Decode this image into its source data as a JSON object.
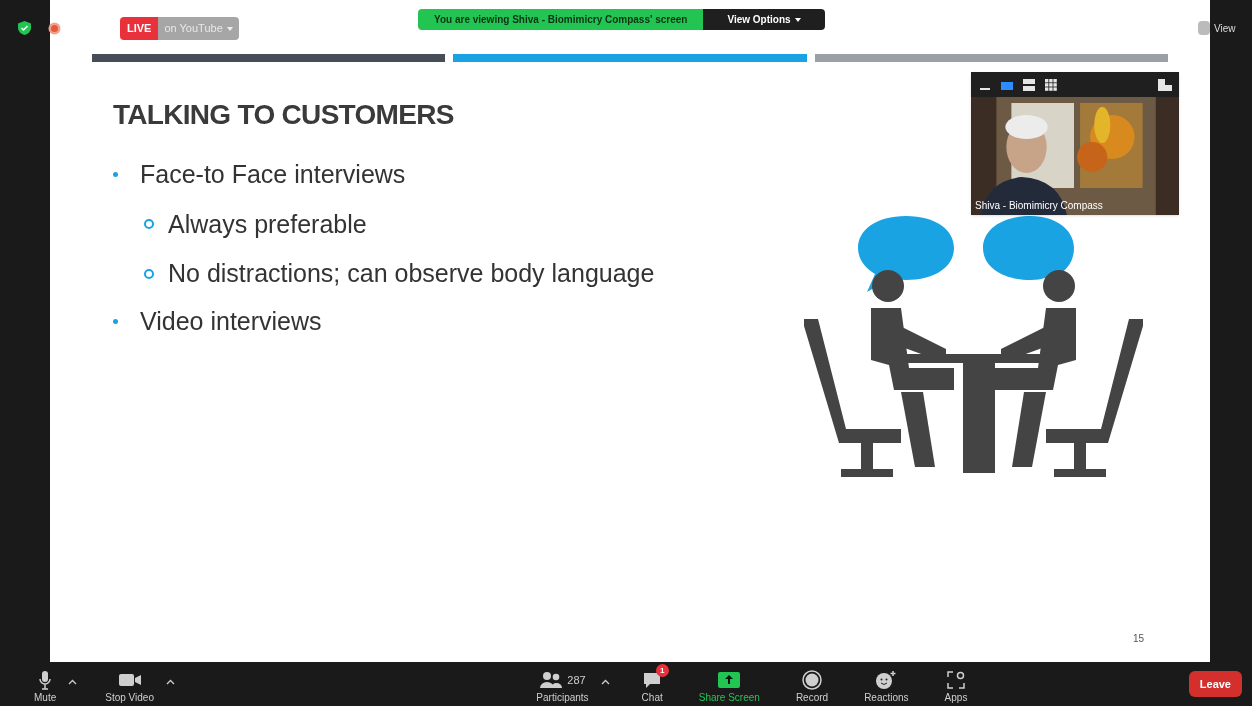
{
  "top_bar": {
    "live": {
      "label": "LIVE",
      "destination": "on YouTube"
    },
    "banner": {
      "text": "You are viewing Shiva - Biomimicry Compass' screen",
      "button": "View Options"
    },
    "view_button": "View"
  },
  "slide": {
    "title": "TALKING TO CUSTOMERS",
    "bullets": [
      {
        "text": "Face-to Face interviews",
        "children": [
          {
            "text": "Always preferable"
          },
          {
            "text": "No distractions; can observe body language"
          }
        ]
      },
      {
        "text": "Video interviews"
      }
    ],
    "page_number": "15"
  },
  "video": {
    "name": "Shiva - Biomimicry Compass",
    "layouts": [
      {
        "kind": "minimize",
        "selected": false
      },
      {
        "kind": "speaker",
        "selected": true
      },
      {
        "kind": "stack",
        "selected": false
      },
      {
        "kind": "grid",
        "selected": false
      }
    ]
  },
  "toolbar": {
    "left": [
      {
        "kind": "mic",
        "label": "Mute",
        "caret": true
      },
      {
        "kind": "camera",
        "label": "Stop Video",
        "caret": true
      }
    ],
    "center": [
      {
        "kind": "participants",
        "label": "Participants",
        "count": "287",
        "caret": true
      },
      {
        "kind": "chat",
        "label": "Chat",
        "badge": "1"
      },
      {
        "kind": "share",
        "label": "Share Screen"
      },
      {
        "kind": "record",
        "label": "Record"
      },
      {
        "kind": "reactions",
        "label": "Reactions"
      },
      {
        "kind": "apps",
        "label": "Apps"
      }
    ],
    "leave": "Leave"
  }
}
